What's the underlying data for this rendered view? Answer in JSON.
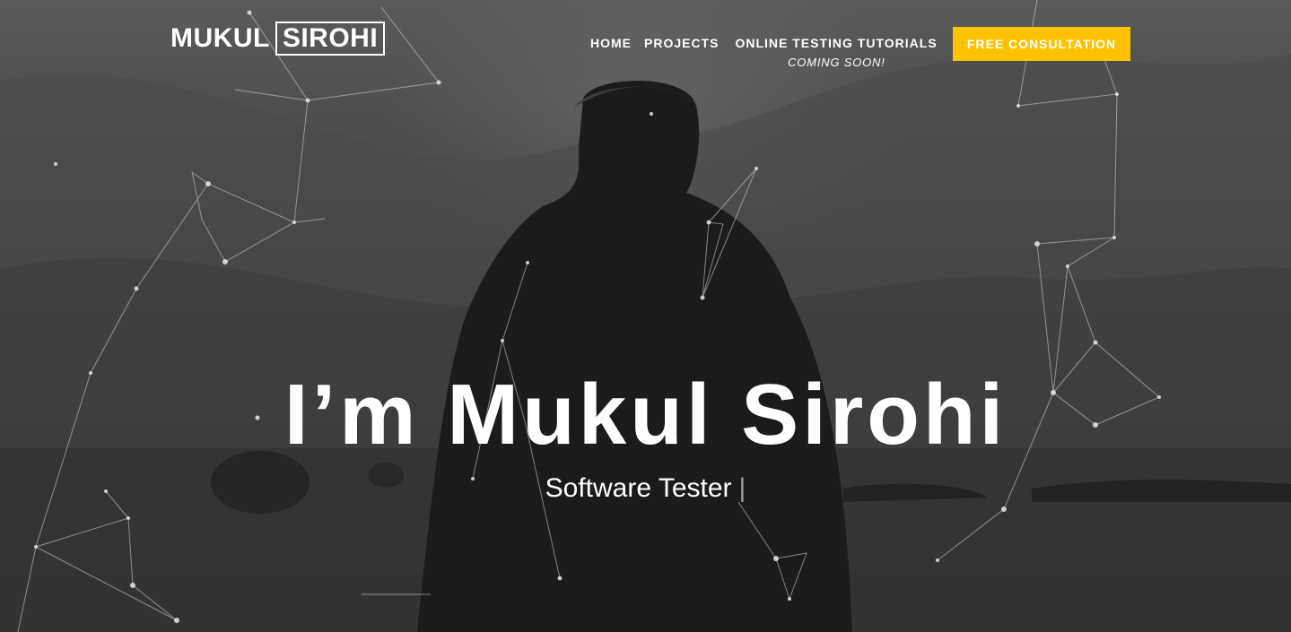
{
  "header": {
    "logo_first": "MUKUL",
    "logo_second": "SIROHI"
  },
  "nav": {
    "items": [
      {
        "label": "HOME"
      },
      {
        "label": "PROJECTS"
      },
      {
        "label": "ONLINE TESTING TUTORIALS",
        "sublabel": "COMING SOON!"
      }
    ],
    "cta_label": "FREE CONSULTATION"
  },
  "hero": {
    "headline": "I’m Mukul Sirohi",
    "subtitle": "Software Tester",
    "cursor": "|"
  },
  "colors": {
    "accent": "#fdc300",
    "text": "#ffffff",
    "network": "#d8d8d8"
  }
}
